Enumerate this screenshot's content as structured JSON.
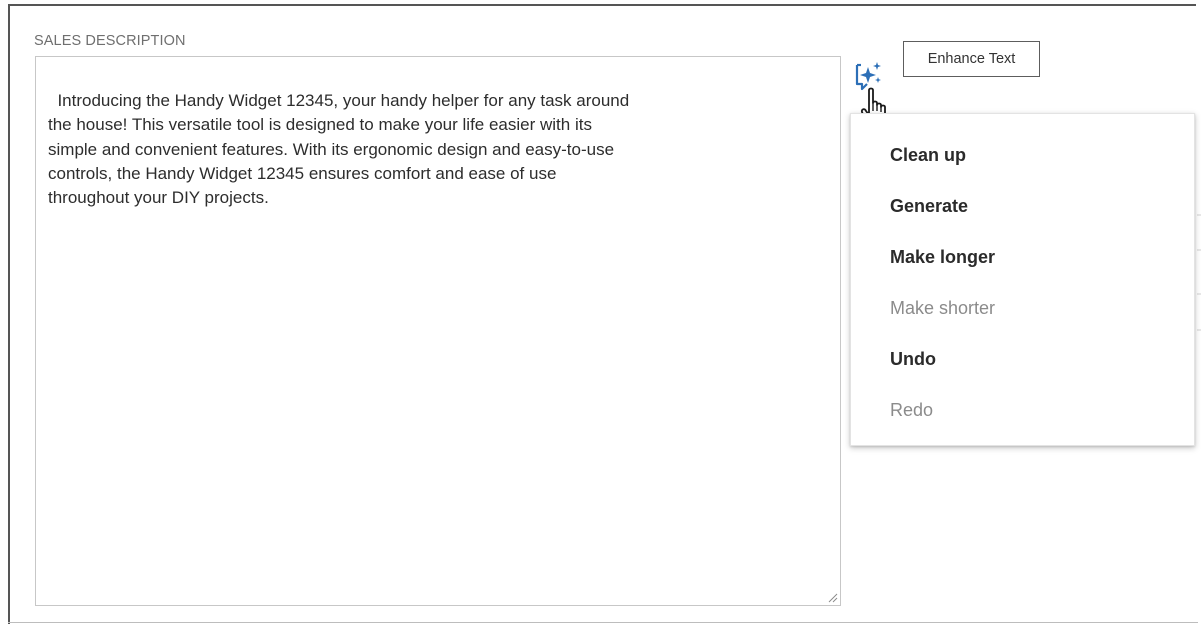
{
  "field": {
    "label": "SALES DESCRIPTION",
    "value": "Introducing the Handy Widget 12345, your handy helper for any task around\nthe house! This versatile tool is designed to make your life easier with its\nsimple and convenient features. With its ergonomic design and easy-to-use\ncontrols, the Handy Widget 12345 ensures comfort and ease of use\nthroughout your DIY projects."
  },
  "enhance": {
    "icon": "sparkle-icon",
    "tooltip": "Enhance Text"
  },
  "cursor": {
    "icon": "hand-pointer-icon"
  },
  "menu": {
    "items": [
      {
        "label": "Clean up",
        "enabled": true
      },
      {
        "label": "Generate",
        "enabled": true
      },
      {
        "label": "Make longer",
        "enabled": true
      },
      {
        "label": "Make shorter",
        "enabled": false
      },
      {
        "label": "Undo",
        "enabled": true
      },
      {
        "label": "Redo",
        "enabled": false
      }
    ]
  },
  "colors": {
    "accent": "#2c6fb7",
    "text": "#2d2d2d",
    "disabled": "#8b8b8b"
  }
}
